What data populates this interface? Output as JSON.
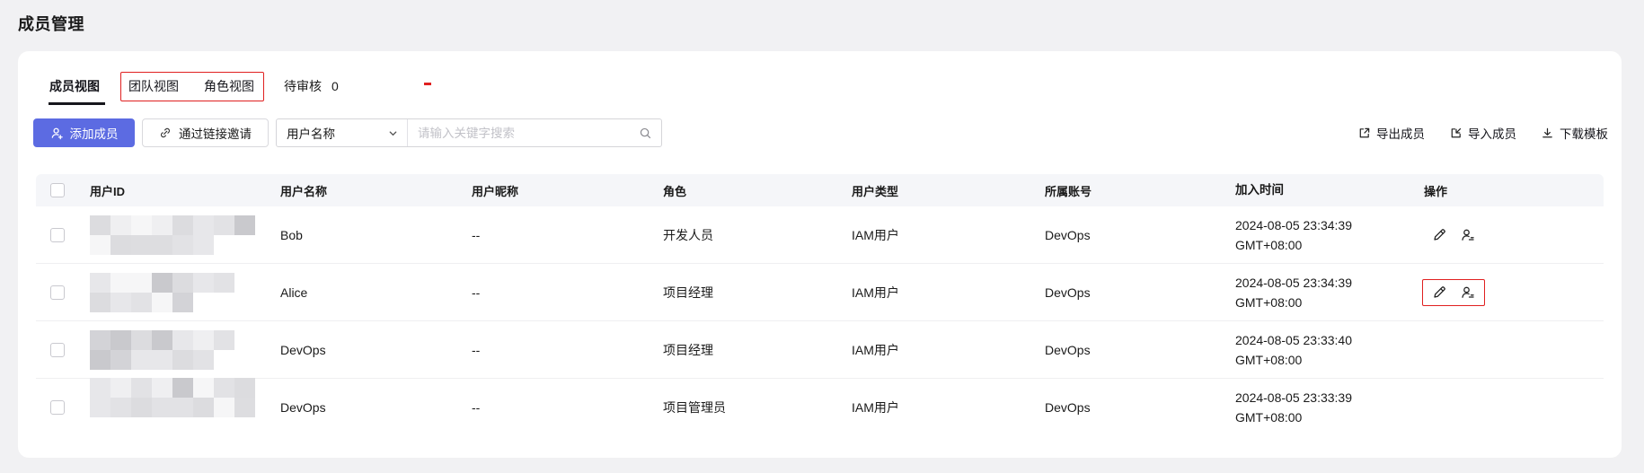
{
  "page": {
    "title": "成员管理"
  },
  "colors": {
    "accent": "#5c6be2",
    "annotation": "#e02020",
    "page_bg": "#f1f1f3",
    "header_bg": "#f5f6f9"
  },
  "tabs": {
    "member_view": "成员视图",
    "team_view": "团队视图",
    "role_view": "角色视图",
    "pending_label": "待审核",
    "pending_count": "0"
  },
  "toolbar": {
    "add_member_label": "添加成员",
    "add_member_icon": "user-plus-icon",
    "invite_label": "通过链接邀请",
    "invite_icon": "link-icon",
    "filter_selected": "用户名称",
    "filter_icon": "chevron-down-icon",
    "search_placeholder": "请输入关键字搜索",
    "search_icon": "magnifier-icon",
    "export_label": "导出成员",
    "import_label": "导入成员",
    "download_label": "下载模板"
  },
  "table": {
    "columns": {
      "id": "用户ID",
      "name": "用户名称",
      "nickname": "用户昵称",
      "role": "角色",
      "type": "用户类型",
      "account": "所属账号",
      "joined": "加入时间",
      "ops": "操作"
    },
    "rows": [
      {
        "name": "Bob",
        "nickname": "--",
        "role": "开发人员",
        "type": "IAM用户",
        "account": "DevOps",
        "joined_date": "2024-08-05 23:34:39",
        "joined_tz": "GMT+08:00",
        "has_actions": true,
        "annotated": false,
        "id_redacted": true
      },
      {
        "name": "Alice",
        "nickname": "--",
        "role": "项目经理",
        "type": "IAM用户",
        "account": "DevOps",
        "joined_date": "2024-08-05 23:34:39",
        "joined_tz": "GMT+08:00",
        "has_actions": true,
        "annotated": true,
        "id_redacted": true
      },
      {
        "name": "DevOps",
        "nickname": "--",
        "role": "项目经理",
        "type": "IAM用户",
        "account": "DevOps",
        "joined_date": "2024-08-05 23:33:40",
        "joined_tz": "GMT+08:00",
        "has_actions": false,
        "annotated": false,
        "id_redacted": true
      },
      {
        "name": "DevOps",
        "nickname": "--",
        "role": "项目管理员",
        "type": "IAM用户",
        "account": "DevOps",
        "joined_date": "2024-08-05 23:33:39",
        "joined_tz": "GMT+08:00",
        "has_actions": false,
        "annotated": false,
        "id_redacted": true
      }
    ],
    "row_action_icons": [
      "pencil-icon",
      "user-role-icon"
    ]
  }
}
